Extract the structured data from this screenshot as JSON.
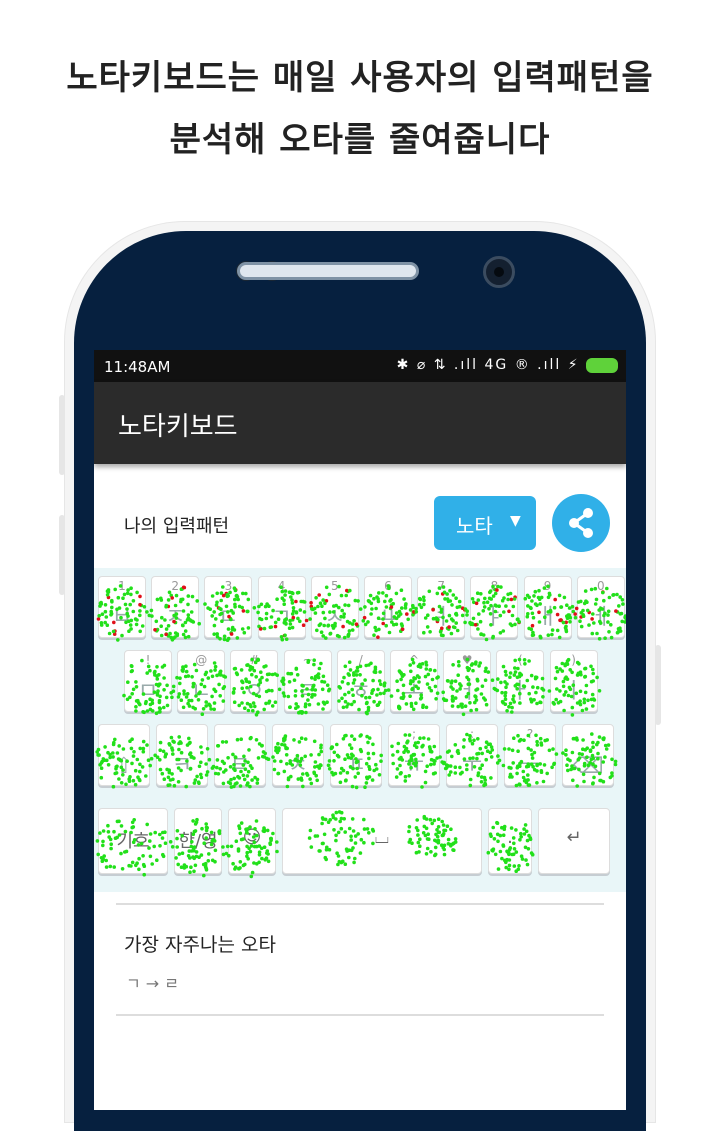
{
  "headline": {
    "line1": "노타키보드는 매일 사용자의 입력패턴을",
    "line2": "분석해 오타를 줄여줍니다"
  },
  "status_bar": {
    "time": "11:48AM",
    "icons": "✱ ⌀ ⇅ .ıll 4G ® .ıll ⚡"
  },
  "app": {
    "title": "노타키보드",
    "pattern_label": "나의 입력패턴",
    "selector": {
      "value": "노타",
      "arrow": "▼"
    },
    "share_icon": "share-icon"
  },
  "keyboard": {
    "row1": [
      {
        "hint": "1",
        "label": "ㅂ"
      },
      {
        "hint": "2",
        "label": "ㅈ"
      },
      {
        "hint": "3",
        "label": "ㄷ"
      },
      {
        "hint": "4",
        "label": "ㄱ"
      },
      {
        "hint": "5",
        "label": "ㅅ"
      },
      {
        "hint": "6",
        "label": "ㅛ"
      },
      {
        "hint": "7",
        "label": "ㅕ"
      },
      {
        "hint": "8",
        "label": "ㅑ"
      },
      {
        "hint": "9",
        "label": "ㅐ"
      },
      {
        "hint": "0",
        "label": "ㅔ"
      }
    ],
    "row2": [
      {
        "hint": "!",
        "label": "ㅁ"
      },
      {
        "hint": "@",
        "label": "ㄴ"
      },
      {
        "hint": "#",
        "label": "ㅇ"
      },
      {
        "hint": "~",
        "label": "ㄹ"
      },
      {
        "hint": "/",
        "label": "ㅎ"
      },
      {
        "hint": "^",
        "label": "ㅗ"
      },
      {
        "hint": "♥",
        "label": "ㅓ"
      },
      {
        "hint": "(",
        "label": "ㅏ"
      },
      {
        "hint": ")",
        "label": "ㅣ"
      }
    ],
    "row3": [
      {
        "hint": "",
        "label": "⇧"
      },
      {
        "hint": "",
        "label": "ㅋ"
      },
      {
        "hint": "",
        "label": "ㅌ"
      },
      {
        "hint": "",
        "label": "ㅊ"
      },
      {
        "hint": "",
        "label": "ㅍ"
      },
      {
        "hint": ";",
        "label": "ㅠ"
      },
      {
        "hint": ":",
        "label": "ㅜ"
      },
      {
        "hint": "?",
        "label": "ㅡ"
      },
      {
        "hint": "",
        "label": "⌫"
      }
    ],
    "row4": [
      {
        "label": "기호"
      },
      {
        "label": "한/영"
      },
      {
        "label": "☺"
      },
      {
        "label": "⌴"
      },
      {
        "label": "."
      },
      {
        "label": "↵"
      }
    ],
    "heatmap": {
      "hit_color": "#22e01a",
      "miss_color": "#e0101a"
    }
  },
  "typo": {
    "label": "가장 자주나는 오타",
    "value": "ㄱ → ㄹ"
  },
  "colors": {
    "accent": "#30b0e8",
    "appbar": "#2b2b2b",
    "phone_bezel": "#06203f"
  }
}
